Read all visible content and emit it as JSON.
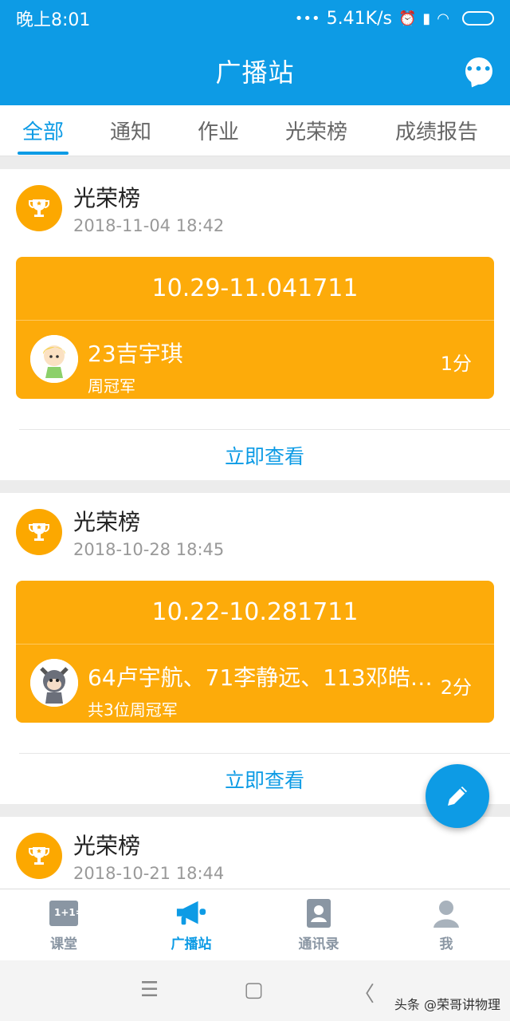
{
  "status_bar": {
    "time": "晚上8:01",
    "dots": "•••",
    "speed": "5.41K/s"
  },
  "app_bar": {
    "title": "广播站",
    "chat_icon": "chat-bubble-icon"
  },
  "tabs": [
    {
      "label": "全部"
    },
    {
      "label": "通知"
    },
    {
      "label": "作业"
    },
    {
      "label": "光荣榜"
    },
    {
      "label": "成绩报告"
    }
  ],
  "feed": [
    {
      "title": "光荣榜",
      "date": "2018-11-04 18:42",
      "period": "10.29-11.041711",
      "names": "23吉宇琪",
      "subtitle": "周冠军",
      "score": "1分",
      "link": "立即查看"
    },
    {
      "title": "光荣榜",
      "date": "2018-10-28 18:45",
      "period": "10.22-10.281711",
      "names": "64卢宇航、71李静远、113邓皓…",
      "subtitle": "共3位周冠军",
      "score": "2分",
      "link": "立即查看"
    },
    {
      "title": "光荣榜",
      "date": "2018-10-21 18:44"
    }
  ],
  "bottom_nav": [
    {
      "label": "课堂",
      "icon": "classroom-icon"
    },
    {
      "label": "广播站",
      "icon": "megaphone-icon"
    },
    {
      "label": "通讯录",
      "icon": "contacts-icon"
    },
    {
      "label": "我",
      "icon": "profile-icon"
    }
  ],
  "system_nav": {
    "menu": "☰",
    "home": "▢",
    "back": "〈"
  },
  "watermark": "头条 @荣哥讲物理",
  "colors": {
    "primary": "#0d9be5",
    "gold": "#fdab0a",
    "trophy": "#fca800"
  }
}
